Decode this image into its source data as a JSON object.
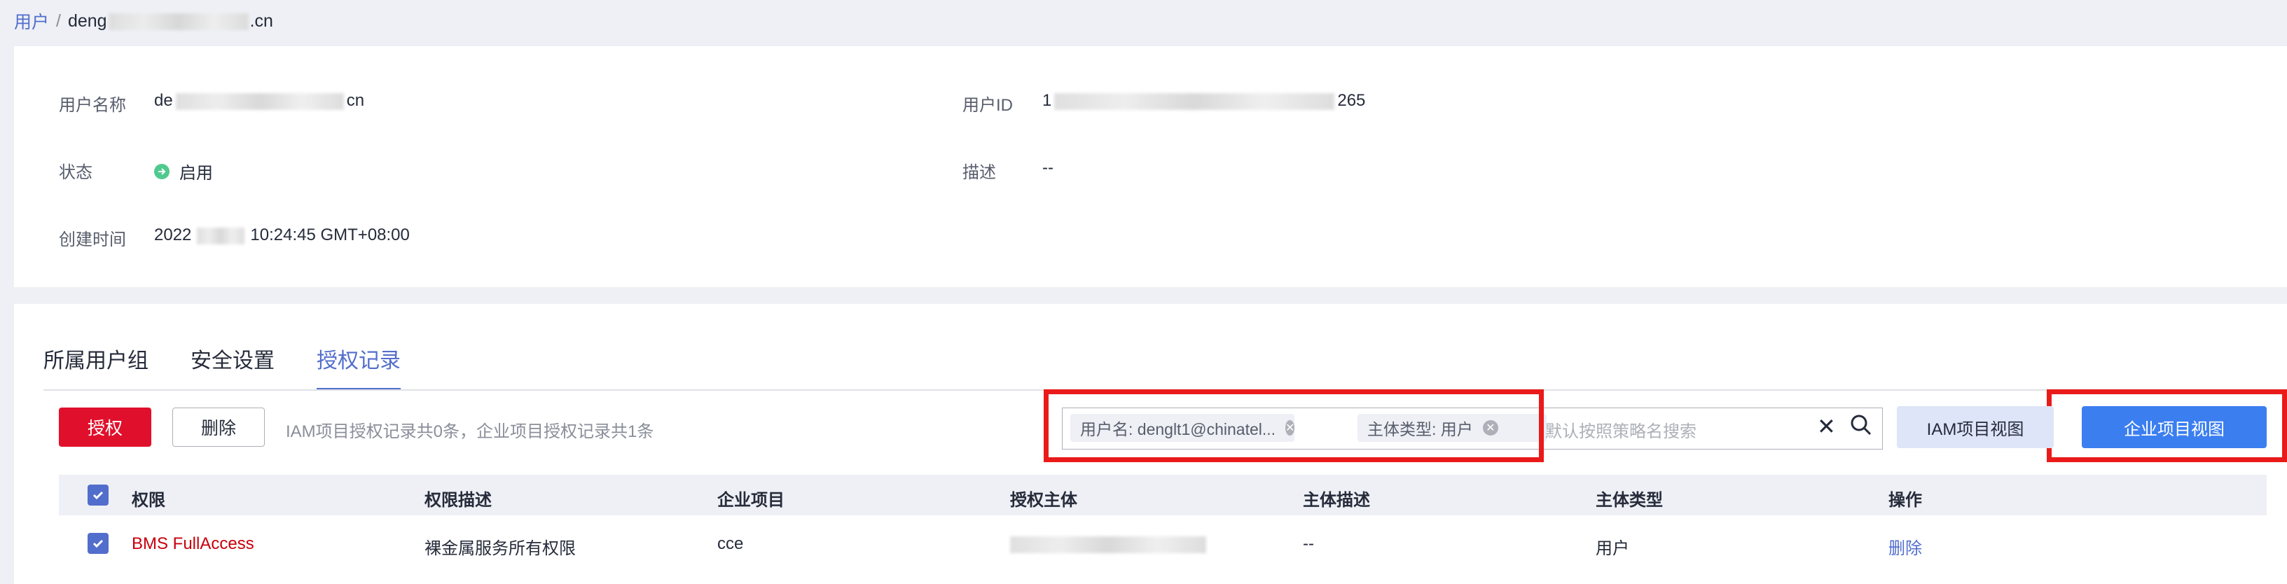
{
  "breadcrumb": {
    "root": "用户",
    "separator": "/",
    "current_prefix": "deng",
    "current_suffix": ".cn"
  },
  "user_detail": {
    "username_label": "用户名称",
    "username_prefix": "de",
    "username_suffix": "cn",
    "user_id_label": "用户ID",
    "user_id_prefix": "1",
    "user_id_suffix": "265",
    "status_label": "状态",
    "status_value": "启用",
    "description_label": "描述",
    "description_value": "--",
    "created_label": "创建时间",
    "created_prefix": "2022",
    "created_suffix": "10:24:45 GMT+08:00"
  },
  "tabs": [
    {
      "label": "所属用户组",
      "active": false
    },
    {
      "label": "安全设置",
      "active": false
    },
    {
      "label": "授权记录",
      "active": true
    }
  ],
  "toolbar": {
    "authorize_label": "授权",
    "delete_label": "删除",
    "summary": "IAM项目授权记录共0条，企业项目授权记录共1条",
    "chip_username": "用户名: denglt1@chinatel...",
    "chip_type": "主体类型: 用户",
    "search_placeholder": "默认按照策略名搜索",
    "iam_view_label": "IAM项目视图",
    "enterprise_view_label": "企业项目视图"
  },
  "table": {
    "columns": [
      "权限",
      "权限描述",
      "企业项目",
      "授权主体",
      "主体描述",
      "主体类型",
      "操作"
    ],
    "rows": [
      {
        "permission": "BMS FullAccess",
        "permission_desc": "裸金属服务所有权限",
        "enterprise_project": "cce",
        "principal_desc": "--",
        "principal_type": "用户",
        "action": "删除"
      }
    ]
  },
  "colors": {
    "accent": "#526ecc",
    "danger": "#e0102c",
    "primary": "#3b7ef0",
    "highlight_frame": "#ea1a1a"
  },
  "icons": [
    "enabled-status-icon",
    "chip-clear-icon",
    "clear-search-icon",
    "search-icon",
    "checkbox-checked-icon"
  ]
}
